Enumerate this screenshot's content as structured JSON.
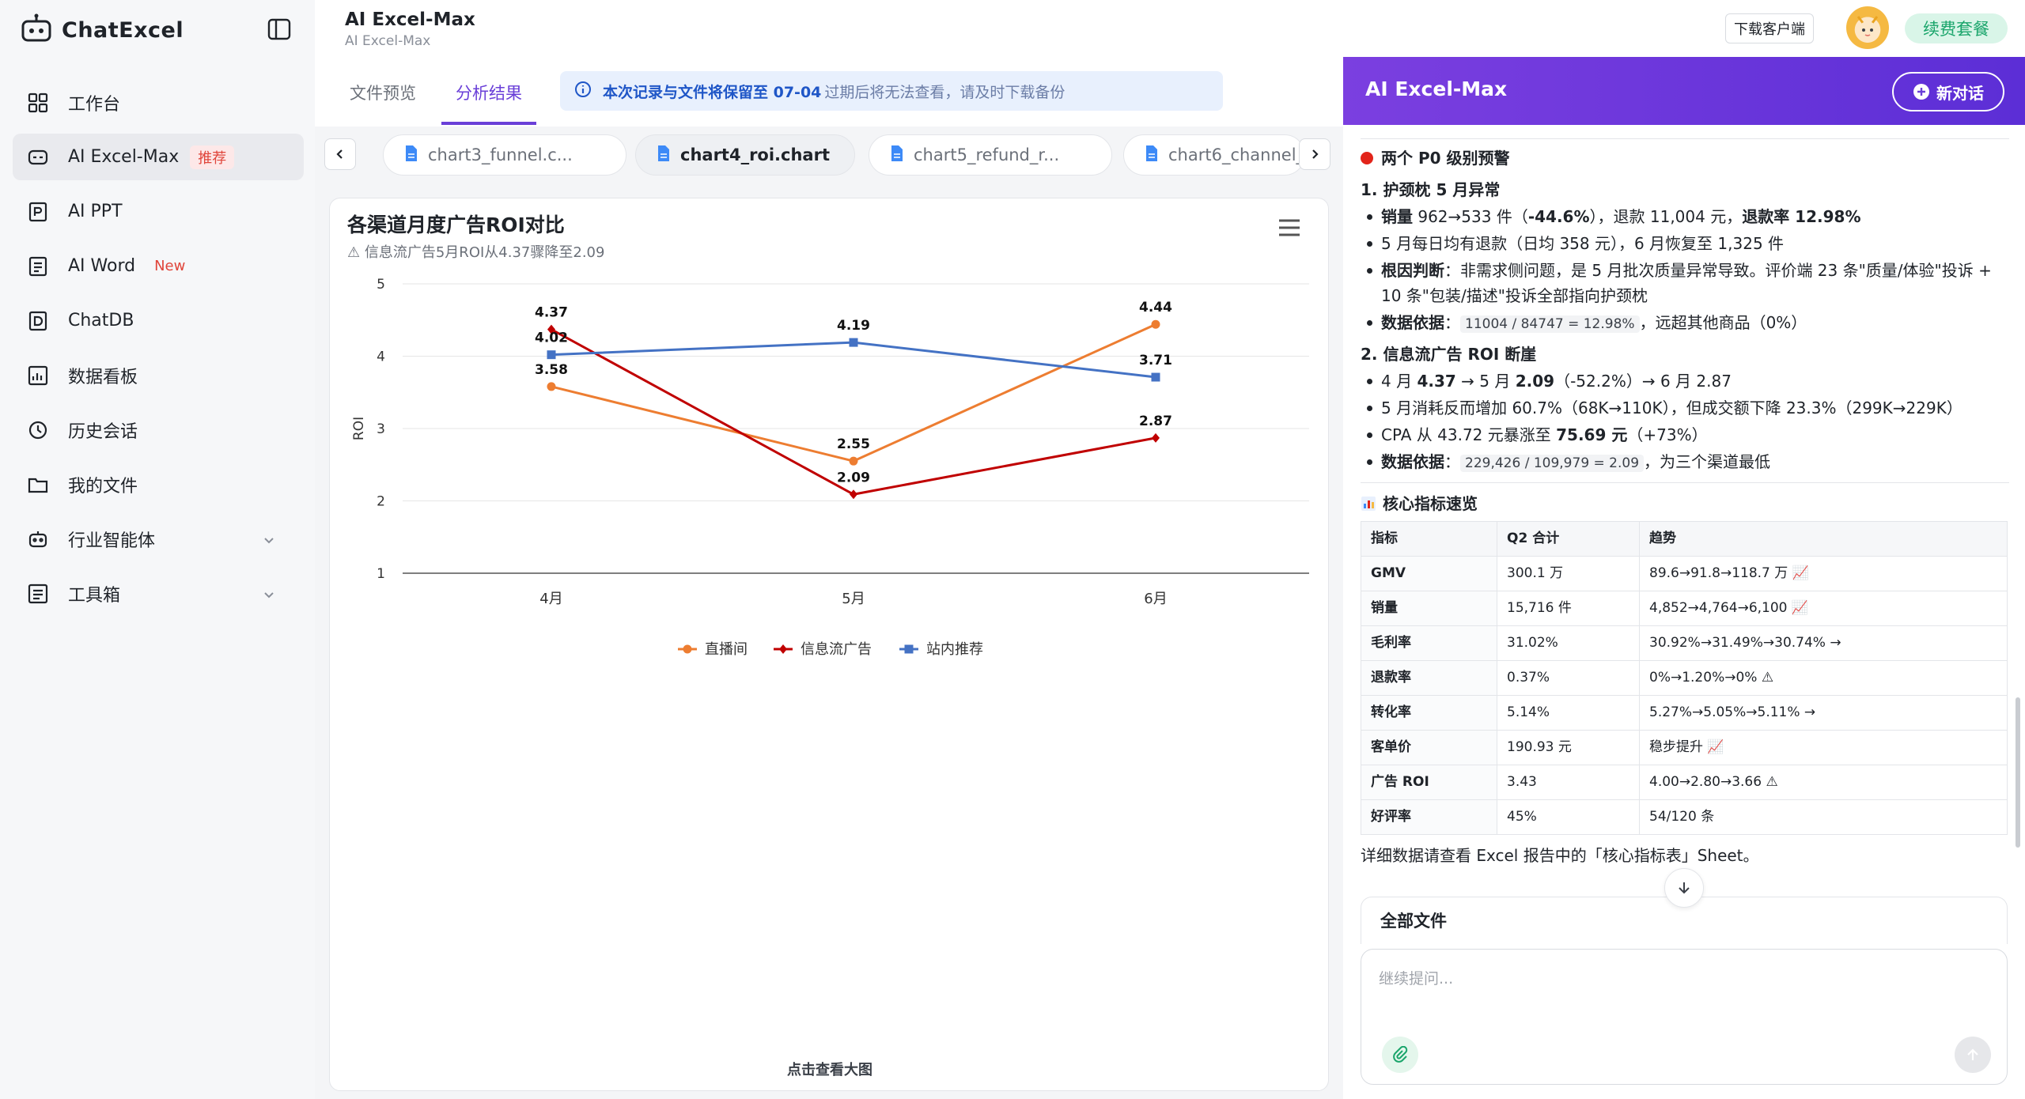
{
  "sidebar": {
    "logo_text": "ChatExcel",
    "items": [
      {
        "label": "工作台",
        "icon": "grid-icon"
      },
      {
        "label": "AI Excel-Max",
        "icon": "ai-excel-icon",
        "tag": "推荐"
      },
      {
        "label": "AI PPT",
        "icon": "ppt-icon"
      },
      {
        "label": "AI Word",
        "icon": "word-icon",
        "tag": "New"
      },
      {
        "label": "ChatDB",
        "icon": "database-icon"
      },
      {
        "label": "数据看板",
        "icon": "dashboard-icon"
      },
      {
        "label": "历史会话",
        "icon": "history-icon"
      },
      {
        "label": "我的文件",
        "icon": "folder-icon"
      },
      {
        "label": "行业智能体",
        "icon": "robot-icon"
      },
      {
        "label": "工具箱",
        "icon": "toolbox-icon"
      }
    ]
  },
  "header": {
    "title": "AI Excel-Max",
    "subtitle": "AI Excel-Max",
    "download_label": "下载客户端",
    "renew_label": "续费套餐"
  },
  "main": {
    "tabs": [
      {
        "label": "文件预览"
      },
      {
        "label": "分析结果"
      }
    ],
    "notice_bold": "本次记录与文件将保留至 07-04",
    "notice_rest": "过期后将无法查看，请及时下载备份",
    "files": [
      {
        "name": "chart3_funnel.c..."
      },
      {
        "name": "chart4_roi.chart"
      },
      {
        "name": "chart5_refund_r..."
      },
      {
        "name": "chart6_channel_"
      }
    ],
    "chart_footer": "点击查看大图"
  },
  "chart_data": {
    "type": "line",
    "title": "各渠道月度广告ROI对比",
    "subtitle": "⚠ 信息流广告5月ROI从4.37骤降至2.09",
    "xlabel": "",
    "ylabel": "ROI",
    "categories": [
      "4月",
      "5月",
      "6月"
    ],
    "ylim": [
      1,
      5
    ],
    "yticks": [
      "1",
      "2",
      "3",
      "4",
      "5"
    ],
    "grid": true,
    "legend": "bottom",
    "series": [
      {
        "name": "直播间",
        "values": [
          3.58,
          2.55,
          4.44
        ],
        "labels": [
          "3.58",
          "2.55",
          "4.44"
        ],
        "color": "#ed7d31",
        "marker": "circle"
      },
      {
        "name": "信息流广告",
        "values": [
          4.37,
          2.09,
          2.87
        ],
        "labels": [
          "4.37",
          "2.09",
          "2.87"
        ],
        "color": "#c00000",
        "marker": "diamond"
      },
      {
        "name": "站内推荐",
        "values": [
          4.02,
          4.19,
          3.71
        ],
        "labels": [
          "4.02",
          "4.19",
          "3.71"
        ],
        "color": "#4472c4",
        "marker": "square"
      }
    ]
  },
  "right": {
    "title": "AI Excel-Max",
    "new_chat_label": "新对话",
    "alert_title": "两个 P0 级别预警",
    "s1_title": "1. 护颈枕 5 月异常",
    "s1_b1_a": "销量",
    "s1_b1_b": " 962→533 件（",
    "s1_b1_c": "-44.6%",
    "s1_b1_d": "），退款 11,004 元，",
    "s1_b1_e": "退款率 12.98%",
    "s1_b2": "5 月每日均有退款（日均 358 元），6 月恢复至 1,325 件",
    "s1_b3_a": "根因判断",
    "s1_b3_b": "：非需求侧问题，是 5 月批次质量异常导致。评价端 23 条\"质量/体验\"投诉 + 10 条\"包装/描述\"投诉全部指向护颈枕",
    "s1_b4_a": "数据依据",
    "s1_b4_b": "：",
    "s1_b4_code": "11004 / 84747 = 12.98%",
    "s1_b4_c": "，远超其他商品（0%）",
    "s2_title": "2. 信息流广告 ROI 断崖",
    "s2_b1_a": "4 月 ",
    "s2_b1_b": "4.37",
    "s2_b1_c": " → 5 月 ",
    "s2_b1_d": "2.09",
    "s2_b1_e": "（-52.2%）→ 6 月 2.87",
    "s2_b2": "5 月消耗反而增加 60.7%（68K→110K），但成交额下降 23.3%（299K→229K）",
    "s2_b3_a": "CPA 从 43.72 元暴涨至 ",
    "s2_b3_b": "75.69 元",
    "s2_b3_c": "（+73%）",
    "s2_b4_a": "数据依据",
    "s2_b4_b": "：",
    "s2_b4_code": "229,426 / 109,979 = 2.09",
    "s2_b4_c": "，为三个渠道最低",
    "kpi_title": "核心指标速览",
    "kpi_headers": [
      "指标",
      "Q2 合计",
      "趋势"
    ],
    "kpi_rows": [
      [
        "GMV",
        "300.1 万",
        "89.6→91.8→118.7 万 📈"
      ],
      [
        "销量",
        "15,716 件",
        "4,852→4,764→6,100 📈"
      ],
      [
        "毛利率",
        "31.02%",
        "30.92%→31.49%→30.74% →"
      ],
      [
        "退款率",
        "0.37%",
        "0%→1.20%→0% ⚠"
      ],
      [
        "转化率",
        "5.14%",
        "5.27%→5.05%→5.11% →"
      ],
      [
        "客单价",
        "190.93 元",
        "稳步提升 📈"
      ],
      [
        "广告 ROI",
        "3.43",
        "4.00→2.80→3.66 ⚠"
      ],
      [
        "好评率",
        "45%",
        "54/120 条"
      ]
    ],
    "detail_note": "详细数据请查看 Excel 报告中的「核心指标表」Sheet。",
    "all_files_label": "全部文件",
    "input_placeholder": "继续提问..."
  }
}
